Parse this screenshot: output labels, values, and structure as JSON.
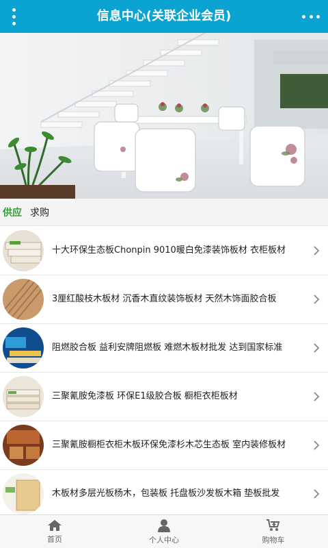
{
  "header": {
    "title": "信息中心(关联企业会员)"
  },
  "banner": {
    "slides_count": 3,
    "active_slide": 2
  },
  "tabs": [
    {
      "label": "供应",
      "active": true
    },
    {
      "label": "求购",
      "active": false
    }
  ],
  "list": {
    "items": [
      {
        "text": "十大环保生态板Chonpin 9010暖白免漆装饰板材 衣柜板材"
      },
      {
        "text": "3厘红酸枝木板材 沉香木直纹装饰板材 天然木饰面胶合板"
      },
      {
        "text": "阻燃胶合板 益利安牌阻燃板 难燃木板材批发 达到国家标准"
      },
      {
        "text": "三聚氰胺免漆板 环保E1级胶合板 橱柜衣柜板材"
      },
      {
        "text": "三聚氰胺橱柜衣柜木板环保免漆杉木芯生态板 室内装修板材"
      },
      {
        "text": "木板材多层光板杨木，包装板 托盘板沙发板木箱 垫板批发"
      }
    ]
  },
  "bottom_nav": [
    {
      "label": "首页",
      "icon": "home-icon"
    },
    {
      "label": "个人中心",
      "icon": "user-icon"
    },
    {
      "label": "购物车",
      "icon": "cart-icon"
    }
  ],
  "colors": {
    "header_bg": "#0aa3d2",
    "active_tab": "#2e9e35"
  }
}
